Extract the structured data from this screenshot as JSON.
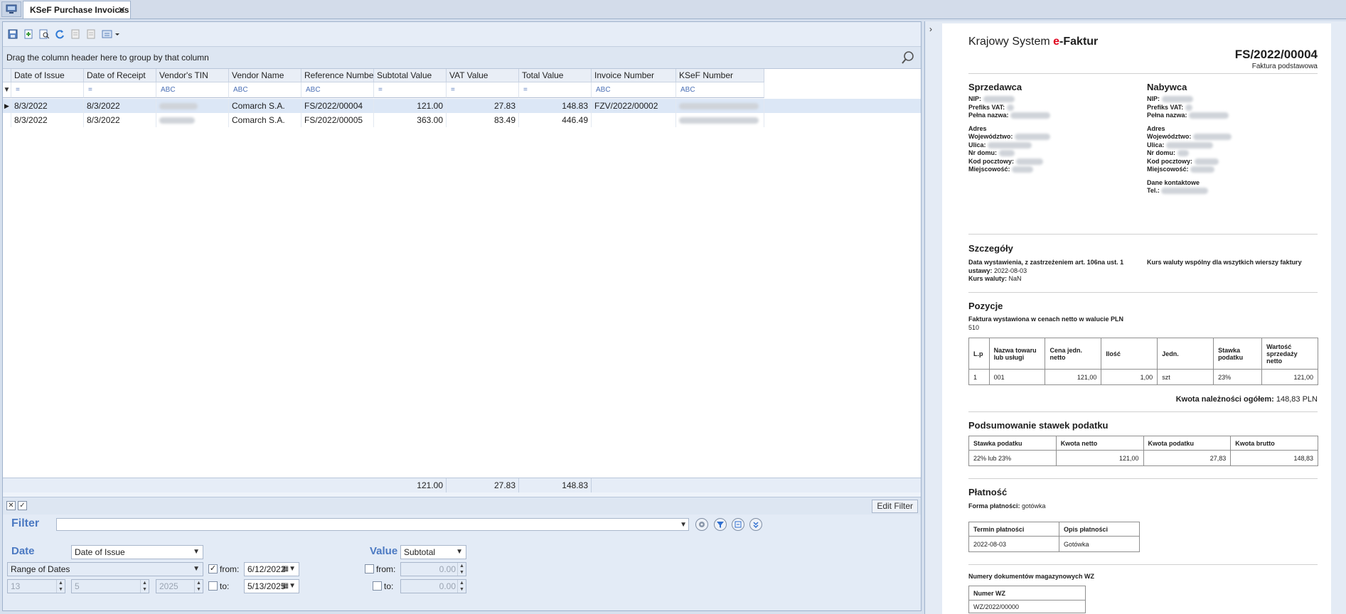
{
  "tab": {
    "title": "KSeF Purchase Invoices",
    "close": "✕"
  },
  "grid": {
    "group_hint": "Drag the column header here to group by that column",
    "columns": [
      "Date of Issue",
      "Date of Receipt",
      "Vendor's TIN",
      "Vendor Name",
      "Reference Number",
      "Subtotal Value",
      "VAT Value",
      "Total Value",
      "Invoice Number",
      "KSeF Number"
    ],
    "filter_eq": "=",
    "filter_abc": "ABC",
    "rows": [
      {
        "date_issue": "8/3/2022",
        "date_receipt": "8/3/2022",
        "vendor_name": "Comarch S.A.",
        "reference": "FS/2022/00004",
        "subtotal": "121.00",
        "vat": "27.83",
        "total": "148.83",
        "invoice": "FZV/2022/00002"
      },
      {
        "date_issue": "8/3/2022",
        "date_receipt": "8/3/2022",
        "vendor_name": "Comarch S.A.",
        "reference": "FS/2022/00005",
        "subtotal": "363.00",
        "vat": "83.49",
        "total": "446.49",
        "invoice": ""
      }
    ],
    "totals": {
      "subtotal": "121.00",
      "vat": "27.83",
      "total": "148.83"
    }
  },
  "filterbar": {
    "edit_filter": "Edit Filter"
  },
  "filter": {
    "filter_label": "Filter",
    "date_label": "Date",
    "date_field": "Date of Issue",
    "range": "Range of Dates",
    "day": "13",
    "month": "5",
    "year": "2025",
    "from_label": "from:",
    "to_label": "to:",
    "from_date": "6/12/2022",
    "to_date": "5/13/2025",
    "value_label": "Value",
    "value_field": "Subtotal",
    "value_from": "0.00",
    "value_to": "0.00"
  },
  "doc": {
    "title_prefix": "Krajowy System ",
    "title_e": "e",
    "title_suffix": "-Faktur",
    "number": "FS/2022/00004",
    "kind": "Faktura podstawowa",
    "seller": "Sprzedawca",
    "buyer": "Nabywca",
    "nip": "NIP:",
    "prefix_vat": "Prefiks VAT:",
    "full_name": "Pełna nazwa:",
    "address": "Adres",
    "province": "Województwo:",
    "street": "Ulica:",
    "house": "Nr domu:",
    "postal": "Kod pocztowy:",
    "city": "Miejscowość:",
    "contact": "Dane kontaktowe",
    "tel": "Tel.:",
    "details": "Szczegóły",
    "issue_date_label": "Data wystawienia, z zastrzeżeniem art. 106na ust. 1",
    "issue_date_label2": "ustawy:",
    "issue_date": "2022-08-03",
    "fx_label": "Kurs waluty:",
    "fx": "NaN",
    "fx_common": "Kurs waluty wspólny dla wszytkich wierszy faktury",
    "positions": "Pozycje",
    "net_note": "Faktura wystawiona w cenach netto w walucie PLN",
    "code": "510",
    "items_head": [
      "L.p",
      "Nazwa towaru lub usługi",
      "Cena jedn. netto",
      "Ilość",
      "Jedn.",
      "Stawka podatku",
      "Wartość sprzedaży netto"
    ],
    "items": [
      [
        "1",
        "001",
        "121,00",
        "1,00",
        "szt",
        "23%",
        "121,00"
      ]
    ],
    "due_label": "Kwota należności ogółem:",
    "due": "148,83 PLN",
    "tax_summary": "Podsumowanie stawek podatku",
    "tax_head": [
      "Stawka podatku",
      "Kwota netto",
      "Kwota podatku",
      "Kwota brutto"
    ],
    "tax_rows": [
      [
        "22% lub 23%",
        "121,00",
        "27,83",
        "148,83"
      ]
    ],
    "payment": "Płatność",
    "payment_form_label": "Forma płatności:",
    "payment_form": "gotówka",
    "pay_head": [
      "Termin płatności",
      "Opis płatności"
    ],
    "pay_rows": [
      [
        "2022-08-03",
        "Gotówka"
      ]
    ],
    "wz_title": "Numery dokumentów magazynowych WZ",
    "wz_head": "Numer WZ",
    "wz_value": "WZ/2022/00000"
  },
  "colors": {
    "accent": "#4b79c2",
    "red": "#e0001b",
    "panel": "#e3ebf6"
  }
}
